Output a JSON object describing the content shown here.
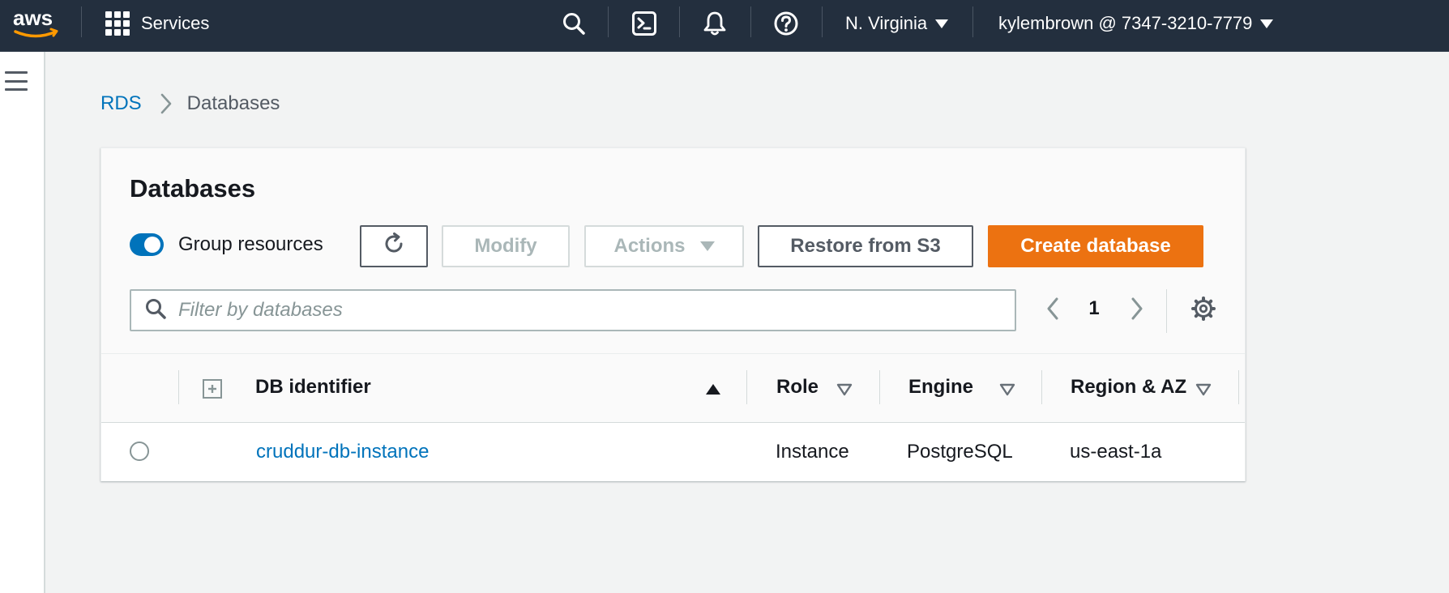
{
  "topnav": {
    "brand": "aws",
    "services_label": "Services",
    "region": "N. Virginia",
    "account": "kylembrown @ 7347-3210-7779",
    "icons": [
      "search-icon",
      "cloudshell-icon",
      "bell-icon",
      "help-icon"
    ]
  },
  "breadcrumb": {
    "root": "RDS",
    "current": "Databases"
  },
  "panel": {
    "title": "Databases",
    "group_resources_label": "Group resources",
    "group_resources_on": true,
    "buttons": {
      "modify": "Modify",
      "actions": "Actions",
      "restore": "Restore from S3",
      "create": "Create database"
    },
    "search_placeholder": "Filter by databases",
    "page": "1"
  },
  "table": {
    "columns": {
      "db_identifier": "DB identifier",
      "role": "Role",
      "engine": "Engine",
      "region_az": "Region & AZ"
    },
    "rows": [
      {
        "db_identifier": "cruddur-db-instance",
        "role": "Instance",
        "engine": "PostgreSQL",
        "region_az": "us-east-1a"
      }
    ]
  },
  "colors": {
    "nav_bg": "#232f3e",
    "link": "#0073bb",
    "primary": "#ec7211",
    "toggle_on": "#0073bb"
  }
}
